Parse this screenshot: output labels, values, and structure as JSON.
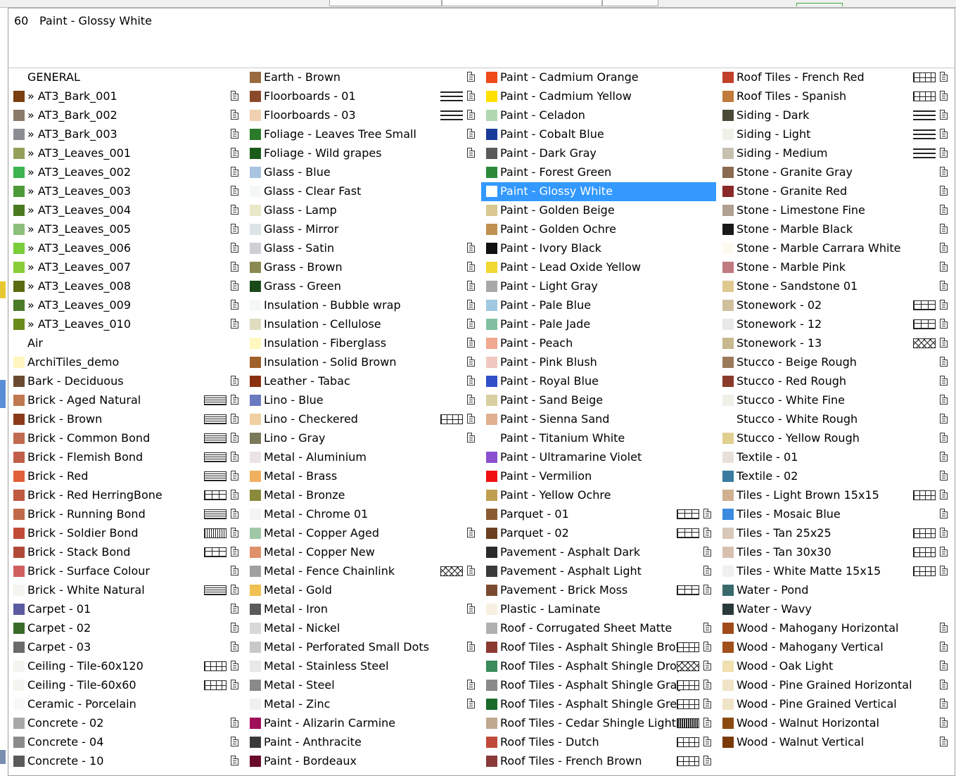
{
  "header": {
    "index": "60",
    "name": "Paint - Glossy White"
  },
  "columns": [
    [
      {
        "label": "GENERAL",
        "color": null,
        "pattern": null,
        "doc": false
      },
      {
        "label": "» AT3_Bark_001",
        "color": "#7a3e10",
        "pattern": null,
        "doc": true
      },
      {
        "label": "» AT3_Bark_002",
        "color": "#8a7a6a",
        "pattern": null,
        "doc": true
      },
      {
        "label": "» AT3_Bark_003",
        "color": "#8c8c94",
        "pattern": null,
        "doc": true
      },
      {
        "label": "» AT3_Leaves_001",
        "color": "#94a05a",
        "pattern": null,
        "doc": true
      },
      {
        "label": "» AT3_Leaves_002",
        "color": "#3cb450",
        "pattern": null,
        "doc": true
      },
      {
        "label": "» AT3_Leaves_003",
        "color": "#4e9a3a",
        "pattern": null,
        "doc": true
      },
      {
        "label": "» AT3_Leaves_004",
        "color": "#4a7a20",
        "pattern": null,
        "doc": true
      },
      {
        "label": "» AT3_Leaves_005",
        "color": "#8cc07a",
        "pattern": null,
        "doc": true
      },
      {
        "label": "» AT3_Leaves_006",
        "color": "#7acc3a",
        "pattern": null,
        "doc": true
      },
      {
        "label": "» AT3_Leaves_007",
        "color": "#88cc38",
        "pattern": null,
        "doc": true
      },
      {
        "label": "» AT3_Leaves_008",
        "color": "#5a6a10",
        "pattern": null,
        "doc": true
      },
      {
        "label": "» AT3_Leaves_009",
        "color": "#4a7a2a",
        "pattern": null,
        "doc": true
      },
      {
        "label": "» AT3_Leaves_010",
        "color": "#6a8a1a",
        "pattern": null,
        "doc": true
      },
      {
        "label": "Air",
        "color": null,
        "pattern": null,
        "doc": false
      },
      {
        "label": "ArchiTiles_demo",
        "color": "#fff5c0",
        "pattern": null,
        "doc": false
      },
      {
        "label": "Bark - Deciduous",
        "color": "#6a4a30",
        "pattern": null,
        "doc": true
      },
      {
        "label": "Brick - Aged Natural",
        "color": "#c07850",
        "pattern": "brick",
        "doc": true
      },
      {
        "label": "Brick - Brown",
        "color": "#8a3a1a",
        "pattern": "brick",
        "doc": true
      },
      {
        "label": "Brick - Common Bond",
        "color": "#c06a50",
        "pattern": "brick",
        "doc": true
      },
      {
        "label": "Brick - Flemish Bond",
        "color": "#c0604a",
        "pattern": "brick",
        "doc": true
      },
      {
        "label": "Brick - Red",
        "color": "#e0603a",
        "pattern": "brick",
        "doc": true
      },
      {
        "label": "Brick - Red HerringBone",
        "color": "#c05a40",
        "pattern": "grid",
        "doc": true
      },
      {
        "label": "Brick - Running Bond",
        "color": "#c06a4a",
        "pattern": "brick",
        "doc": true
      },
      {
        "label": "Brick - Soldier Bond",
        "color": "#c04a38",
        "pattern": "vert",
        "doc": true
      },
      {
        "label": "Brick - Stack Bond",
        "color": "#b04a38",
        "pattern": "grid",
        "doc": true
      },
      {
        "label": "Brick - Surface Colour",
        "color": "#d06060",
        "pattern": null,
        "doc": true
      },
      {
        "label": "Brick - White Natural",
        "color": "#f4f4f0",
        "pattern": "brick",
        "doc": true
      },
      {
        "label": "Carpet - 01",
        "color": "#5a5aa0",
        "pattern": null,
        "doc": true
      },
      {
        "label": "Carpet - 02",
        "color": "#3a6a2a",
        "pattern": null,
        "doc": true
      },
      {
        "label": "Carpet - 03",
        "color": "#6a6a6a",
        "pattern": null,
        "doc": true
      },
      {
        "label": "Ceiling - Tile-60x120",
        "color": "#f4f4f0",
        "pattern": "tile",
        "doc": true
      },
      {
        "label": "Ceiling - Tile-60x60",
        "color": "#f4f4f0",
        "pattern": "tile",
        "doc": true
      },
      {
        "label": "Ceramic - Porcelain",
        "color": "#f8f8f8",
        "pattern": null,
        "doc": false
      },
      {
        "label": "Concrete - 02",
        "color": "#a8a8a8",
        "pattern": null,
        "doc": true
      },
      {
        "label": "Concrete - 04",
        "color": "#8a8a8a",
        "pattern": null,
        "doc": true
      },
      {
        "label": "Concrete - 10",
        "color": "#5a5a5a",
        "pattern": null,
        "doc": true
      }
    ],
    [
      {
        "label": "Earth - Brown",
        "color": "#9a6a40",
        "pattern": null,
        "doc": true
      },
      {
        "label": "Floorboards - 01",
        "color": "#8a4a2a",
        "pattern": "lines",
        "doc": true
      },
      {
        "label": "Floorboards - 03",
        "color": "#f0d0b0",
        "pattern": "lines",
        "doc": true
      },
      {
        "label": "Foliage - Leaves Tree Small",
        "color": "#2a7a2a",
        "pattern": null,
        "doc": true
      },
      {
        "label": "Foliage - Wild grapes",
        "color": "#1a5a1a",
        "pattern": null,
        "doc": true
      },
      {
        "label": "Glass - Blue",
        "color": "#a8c4e0",
        "pattern": null,
        "doc": false
      },
      {
        "label": "Glass - Clear Fast",
        "color": "#f4f8f4",
        "pattern": null,
        "doc": false
      },
      {
        "label": "Glass - Lamp",
        "color": "#e8e8c8",
        "pattern": null,
        "doc": false
      },
      {
        "label": "Glass - Mirror",
        "color": "#dce4e8",
        "pattern": null,
        "doc": false
      },
      {
        "label": "Glass - Satin",
        "color": "#d0d0d4",
        "pattern": null,
        "doc": true
      },
      {
        "label": "Grass - Brown",
        "color": "#8a8a50",
        "pattern": null,
        "doc": true
      },
      {
        "label": "Grass - Green",
        "color": "#1a4a1a",
        "pattern": null,
        "doc": true
      },
      {
        "label": "Insulation - Bubble wrap",
        "color": "#f4f8f4",
        "pattern": null,
        "doc": true
      },
      {
        "label": "Insulation - Cellulose",
        "color": "#e0dcc0",
        "pattern": null,
        "doc": true
      },
      {
        "label": "Insulation - Fiberglass",
        "color": "#fff8c0",
        "pattern": null,
        "doc": true
      },
      {
        "label": "Insulation - Solid Brown",
        "color": "#a0602a",
        "pattern": null,
        "doc": true
      },
      {
        "label": "Leather - Tabac",
        "color": "#8a3010",
        "pattern": null,
        "doc": true
      },
      {
        "label": "Lino - Blue",
        "color": "#6a7ac0",
        "pattern": null,
        "doc": true
      },
      {
        "label": "Lino - Checkered",
        "color": "#f0d0a0",
        "pattern": "tile",
        "doc": true
      },
      {
        "label": "Lino - Gray",
        "color": "#7a7a5a",
        "pattern": null,
        "doc": true
      },
      {
        "label": "Metal - Aluminium",
        "color": "#ece4e4",
        "pattern": null,
        "doc": false
      },
      {
        "label": "Metal - Brass",
        "color": "#f0b060",
        "pattern": null,
        "doc": false
      },
      {
        "label": "Metal - Bronze",
        "color": "#8a8a3a",
        "pattern": null,
        "doc": false
      },
      {
        "label": "Metal - Chrome 01",
        "color": "#f4f4f4",
        "pattern": null,
        "doc": false
      },
      {
        "label": "Metal - Copper Aged",
        "color": "#a0c8a8",
        "pattern": null,
        "doc": true
      },
      {
        "label": "Metal - Copper New",
        "color": "#e0906a",
        "pattern": null,
        "doc": false
      },
      {
        "label": "Metal - Fence Chainlink",
        "color": "#a0a0a0",
        "pattern": "x",
        "doc": true
      },
      {
        "label": "Metal - Gold",
        "color": "#f0c050",
        "pattern": null,
        "doc": false
      },
      {
        "label": "Metal - Iron",
        "color": "#5a5a5a",
        "pattern": null,
        "doc": true
      },
      {
        "label": "Metal - Nickel",
        "color": "#d8d8d8",
        "pattern": null,
        "doc": false
      },
      {
        "label": "Metal - Perforated Small Dots",
        "color": "#c8c8c8",
        "pattern": null,
        "doc": true
      },
      {
        "label": "Metal - Stainless Steel",
        "color": "#e8e8e8",
        "pattern": null,
        "doc": false
      },
      {
        "label": "Metal - Steel",
        "color": "#8a8a8a",
        "pattern": null,
        "doc": true
      },
      {
        "label": "Metal - Zinc",
        "color": "#f0f0f0",
        "pattern": null,
        "doc": true
      },
      {
        "label": "Paint - Alizarin Carmine",
        "color": "#a0105a",
        "pattern": null,
        "doc": false
      },
      {
        "label": "Paint - Anthracite",
        "color": "#3a3a3a",
        "pattern": null,
        "doc": false
      },
      {
        "label": "Paint - Bordeaux",
        "color": "#6a0a2a",
        "pattern": null,
        "doc": false
      }
    ],
    [
      {
        "label": "Paint - Cadmium Orange",
        "color": "#f04a1a",
        "pattern": null,
        "doc": false
      },
      {
        "label": "Paint - Cadmium Yellow",
        "color": "#ffe000",
        "pattern": null,
        "doc": false
      },
      {
        "label": "Paint - Celadon",
        "color": "#b0d8b0",
        "pattern": null,
        "doc": false
      },
      {
        "label": "Paint - Cobalt Blue",
        "color": "#1a3a9a",
        "pattern": null,
        "doc": false
      },
      {
        "label": "Paint - Dark Gray",
        "color": "#5a5a5a",
        "pattern": null,
        "doc": false
      },
      {
        "label": "Paint - Forest Green",
        "color": "#2a8a3a",
        "pattern": null,
        "doc": false
      },
      {
        "label": "Paint - Glossy White",
        "color": "#ffffff",
        "pattern": null,
        "doc": false,
        "selected": true
      },
      {
        "label": "Paint - Golden Beige",
        "color": "#d8c890",
        "pattern": null,
        "doc": false
      },
      {
        "label": "Paint - Golden Ochre",
        "color": "#c09050",
        "pattern": null,
        "doc": false
      },
      {
        "label": "Paint - Ivory Black",
        "color": "#101010",
        "pattern": null,
        "doc": false
      },
      {
        "label": "Paint - Lead Oxide Yellow",
        "color": "#f0d830",
        "pattern": null,
        "doc": false
      },
      {
        "label": "Paint - Light Gray",
        "color": "#a8a8a8",
        "pattern": null,
        "doc": false
      },
      {
        "label": "Paint - Pale Blue",
        "color": "#a0c8e0",
        "pattern": null,
        "doc": false
      },
      {
        "label": "Paint - Pale Jade",
        "color": "#80c0a0",
        "pattern": null,
        "doc": false
      },
      {
        "label": "Paint - Peach",
        "color": "#f0a890",
        "pattern": null,
        "doc": false
      },
      {
        "label": "Paint - Pink Blush",
        "color": "#f0c8c0",
        "pattern": null,
        "doc": false
      },
      {
        "label": "Paint - Royal Blue",
        "color": "#3050c8",
        "pattern": null,
        "doc": false
      },
      {
        "label": "Paint - Sand Beige",
        "color": "#d8d0a0",
        "pattern": null,
        "doc": false
      },
      {
        "label": "Paint - Sienna Sand",
        "color": "#e0b090",
        "pattern": null,
        "doc": false
      },
      {
        "label": "Paint - Titanium White",
        "color": "#ffffff",
        "pattern": null,
        "doc": false
      },
      {
        "label": "Paint - Ultramarine Violet",
        "color": "#8a50d0",
        "pattern": null,
        "doc": false
      },
      {
        "label": "Paint - Vermilion",
        "color": "#f01010",
        "pattern": null,
        "doc": false
      },
      {
        "label": "Paint - Yellow Ochre",
        "color": "#c0a050",
        "pattern": null,
        "doc": false
      },
      {
        "label": "Parquet - 01",
        "color": "#8a5a30",
        "pattern": "grid",
        "doc": true
      },
      {
        "label": "Parquet - 02",
        "color": "#6a4020",
        "pattern": "grid",
        "doc": true
      },
      {
        "label": "Pavement - Asphalt Dark",
        "color": "#2a2a2a",
        "pattern": null,
        "doc": true
      },
      {
        "label": "Pavement - Asphalt Light",
        "color": "#3a3a3a",
        "pattern": null,
        "doc": true
      },
      {
        "label": "Pavement - Brick Moss",
        "color": "#7a4a30",
        "pattern": "grid",
        "doc": true
      },
      {
        "label": "Plastic - Laminate",
        "color": "#f8f0e0",
        "pattern": null,
        "doc": false
      },
      {
        "label": "Roof - Corrugated Sheet Matte",
        "color": "#b0b0b0",
        "pattern": null,
        "doc": true
      },
      {
        "label": "Roof Tiles - Asphalt Shingle Brown",
        "color": "#8a3a30",
        "pattern": "tile",
        "doc": true
      },
      {
        "label": "Roof Tiles - Asphalt Shingle Drop",
        "color": "#3a8a5a",
        "pattern": "x",
        "doc": true
      },
      {
        "label": "Roof Tiles - Asphalt Shingle Gray",
        "color": "#8a8a8a",
        "pattern": "tile",
        "doc": true
      },
      {
        "label": "Roof Tiles - Asphalt Shingle Green",
        "color": "#1a6a2a",
        "pattern": "tile",
        "doc": true
      },
      {
        "label": "Roof Tiles - Cedar Shingle Light",
        "color": "#c0a890",
        "pattern": "dense",
        "doc": true
      },
      {
        "label": "Roof Tiles - Dutch",
        "color": "#c04a3a",
        "pattern": "tile",
        "doc": true
      },
      {
        "label": "Roof Tiles - French Brown",
        "color": "#8a3a3a",
        "pattern": "tile",
        "doc": true
      }
    ],
    [
      {
        "label": "Roof Tiles - French Red",
        "color": "#c0402a",
        "pattern": "tile",
        "doc": true
      },
      {
        "label": "Roof Tiles - Spanish",
        "color": "#c07a3a",
        "pattern": "tile",
        "doc": true
      },
      {
        "label": "Siding - Dark",
        "color": "#4a4a3a",
        "pattern": "lines",
        "doc": true
      },
      {
        "label": "Siding - Light",
        "color": "#f0f0e8",
        "pattern": "lines",
        "doc": true
      },
      {
        "label": "Siding - Medium",
        "color": "#c8c0b0",
        "pattern": "lines",
        "doc": true
      },
      {
        "label": "Stone - Granite Gray",
        "color": "#8a6a50",
        "pattern": null,
        "doc": true
      },
      {
        "label": "Stone - Granite Red",
        "color": "#8a2a2a",
        "pattern": null,
        "doc": true
      },
      {
        "label": "Stone - Limestone Fine",
        "color": "#b0a090",
        "pattern": null,
        "doc": true
      },
      {
        "label": "Stone - Marble Black",
        "color": "#1a1a1a",
        "pattern": null,
        "doc": true
      },
      {
        "label": "Stone - Marble Carrara White",
        "color": "#fcfaf0",
        "pattern": null,
        "doc": true
      },
      {
        "label": "Stone - Marble Pink",
        "color": "#c07a80",
        "pattern": null,
        "doc": true
      },
      {
        "label": "Stone - Sandstone 01",
        "color": "#e0c890",
        "pattern": null,
        "doc": true
      },
      {
        "label": "Stonework - 02",
        "color": "#d0c0a0",
        "pattern": "grid",
        "doc": true
      },
      {
        "label": "Stonework - 12",
        "color": "#e8e8e8",
        "pattern": "grid",
        "doc": true
      },
      {
        "label": "Stonework - 13",
        "color": "#c8b890",
        "pattern": "x",
        "doc": true
      },
      {
        "label": "Stucco - Beige Rough",
        "color": "#9a7a5a",
        "pattern": null,
        "doc": true
      },
      {
        "label": "Stucco - Red Rough",
        "color": "#8a3a2a",
        "pattern": null,
        "doc": true
      },
      {
        "label": "Stucco - White Fine",
        "color": "#f0f0e8",
        "pattern": null,
        "doc": true
      },
      {
        "label": "Stucco - White Rough",
        "color": "#ffffff",
        "pattern": null,
        "doc": true
      },
      {
        "label": "Stucco - Yellow Rough",
        "color": "#e0d090",
        "pattern": null,
        "doc": true
      },
      {
        "label": "Textile - 01",
        "color": "#e8e0d8",
        "pattern": null,
        "doc": true
      },
      {
        "label": "Textile - 02",
        "color": "#3a7aa0",
        "pattern": null,
        "doc": true
      },
      {
        "label": "Tiles - Light Brown 15x15",
        "color": "#d0b090",
        "pattern": "tile",
        "doc": true
      },
      {
        "label": "Tiles - Mosaic Blue",
        "color": "#3a8ae0",
        "pattern": null,
        "doc": true
      },
      {
        "label": "Tiles - Tan 25x25",
        "color": "#d8c8b8",
        "pattern": "tile",
        "doc": true
      },
      {
        "label": "Tiles - Tan 30x30",
        "color": "#d8c0b0",
        "pattern": "tile",
        "doc": true
      },
      {
        "label": "Tiles - White Matte 15x15",
        "color": "#f0f0f0",
        "pattern": "tile",
        "doc": true
      },
      {
        "label": "Water - Pond",
        "color": "#3a6a6a",
        "pattern": null,
        "doc": false
      },
      {
        "label": "Water - Wavy",
        "color": "#2a3a3a",
        "pattern": null,
        "doc": false
      },
      {
        "label": "Wood - Mahogany Horizontal",
        "color": "#a04a1a",
        "pattern": null,
        "doc": true
      },
      {
        "label": "Wood - Mahogany Vertical",
        "color": "#a0501a",
        "pattern": null,
        "doc": true
      },
      {
        "label": "Wood - Oak Light",
        "color": "#f0e0b0",
        "pattern": null,
        "doc": true
      },
      {
        "label": "Wood - Pine Grained Horizontal",
        "color": "#f0e4c8",
        "pattern": null,
        "doc": true
      },
      {
        "label": "Wood - Pine Grained Vertical",
        "color": "#f0e4c8",
        "pattern": null,
        "doc": true
      },
      {
        "label": "Wood - Walnut Horizontal",
        "color": "#8a4a10",
        "pattern": null,
        "doc": true
      },
      {
        "label": "Wood - Walnut Vertical",
        "color": "#7a3a08",
        "pattern": null,
        "doc": true
      }
    ]
  ]
}
